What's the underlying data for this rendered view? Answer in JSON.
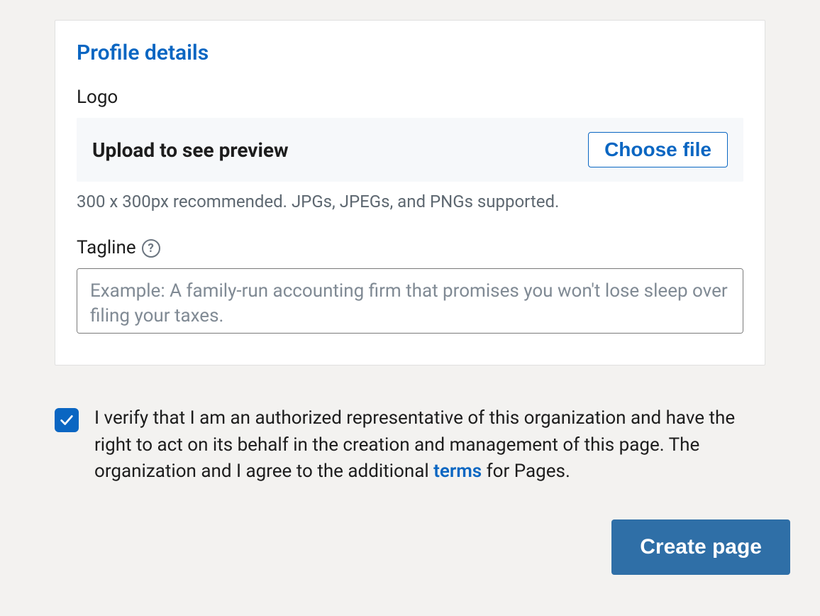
{
  "profile": {
    "section_title": "Profile details",
    "logo": {
      "label": "Logo",
      "upload_preview_text": "Upload to see preview",
      "choose_file_label": "Choose file",
      "helper_text": "300 x 300px recommended. JPGs, JPEGs, and PNGs supported."
    },
    "tagline": {
      "label": "Tagline",
      "placeholder": "Example: A family-run accounting firm that promises you won't lose sleep over filing your taxes."
    }
  },
  "verification": {
    "checked": true,
    "text_before_link": "I verify that I am an authorized representative of this organization and have the right to act on its behalf in the creation and management of this page. The organization and I agree to the additional ",
    "terms_link_label": "terms",
    "text_after_link": " for Pages."
  },
  "actions": {
    "create_page_label": "Create page"
  }
}
